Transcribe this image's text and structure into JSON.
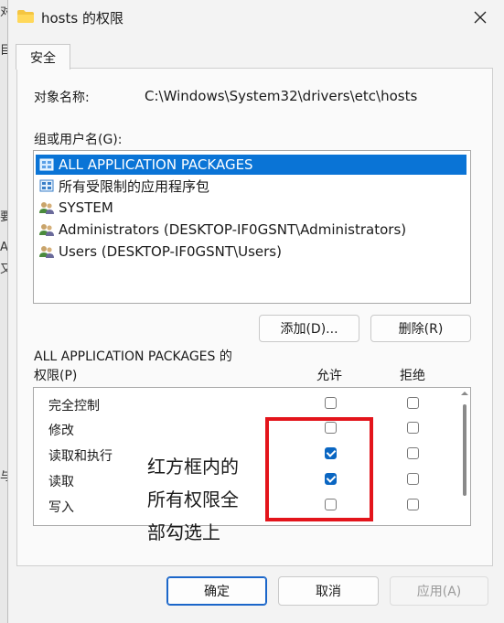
{
  "window": {
    "title": "hosts 的权限"
  },
  "backdrop_glyphs": [
    "对",
    "目",
    "要",
    "A",
    "又",
    "与"
  ],
  "tabs": [
    {
      "label": "安全"
    }
  ],
  "object": {
    "label": "对象名称:",
    "value": "C:\\Windows\\System32\\drivers\\etc\\hosts"
  },
  "groups": {
    "label": "组或用户名(G):",
    "items": [
      {
        "label": "ALL APPLICATION PACKAGES",
        "icon": "package-icon",
        "selected": true
      },
      {
        "label": "所有受限制的应用程序包",
        "icon": "package-icon",
        "selected": false
      },
      {
        "label": "SYSTEM",
        "icon": "users-icon",
        "selected": false
      },
      {
        "label": "Administrators (DESKTOP-IF0GSNT\\Administrators)",
        "icon": "users-icon",
        "selected": false
      },
      {
        "label": "Users (DESKTOP-IF0GSNT\\Users)",
        "icon": "users-icon",
        "selected": false
      }
    ],
    "add_label": "添加(D)...",
    "remove_label": "删除(R)"
  },
  "permissions": {
    "title_line1": "ALL APPLICATION PACKAGES 的",
    "title_line2": "权限(P)",
    "allow_header": "允许",
    "deny_header": "拒绝",
    "rows": [
      {
        "label": "完全控制",
        "allow": false,
        "deny": false
      },
      {
        "label": "修改",
        "allow": false,
        "deny": false
      },
      {
        "label": "读取和执行",
        "allow": true,
        "deny": false
      },
      {
        "label": "读取",
        "allow": true,
        "deny": false
      },
      {
        "label": "写入",
        "allow": false,
        "deny": false
      }
    ]
  },
  "annotation": {
    "line1": "红方框内的",
    "line2": "所有权限全",
    "line3": "部勾选上",
    "box_color": "#e3141b"
  },
  "buttons": {
    "ok": "确定",
    "cancel": "取消",
    "apply": "应用(A)"
  },
  "colors": {
    "selection": "#0a74d6",
    "checkbox": "#0a66c2",
    "accent": "#1b66c9"
  }
}
